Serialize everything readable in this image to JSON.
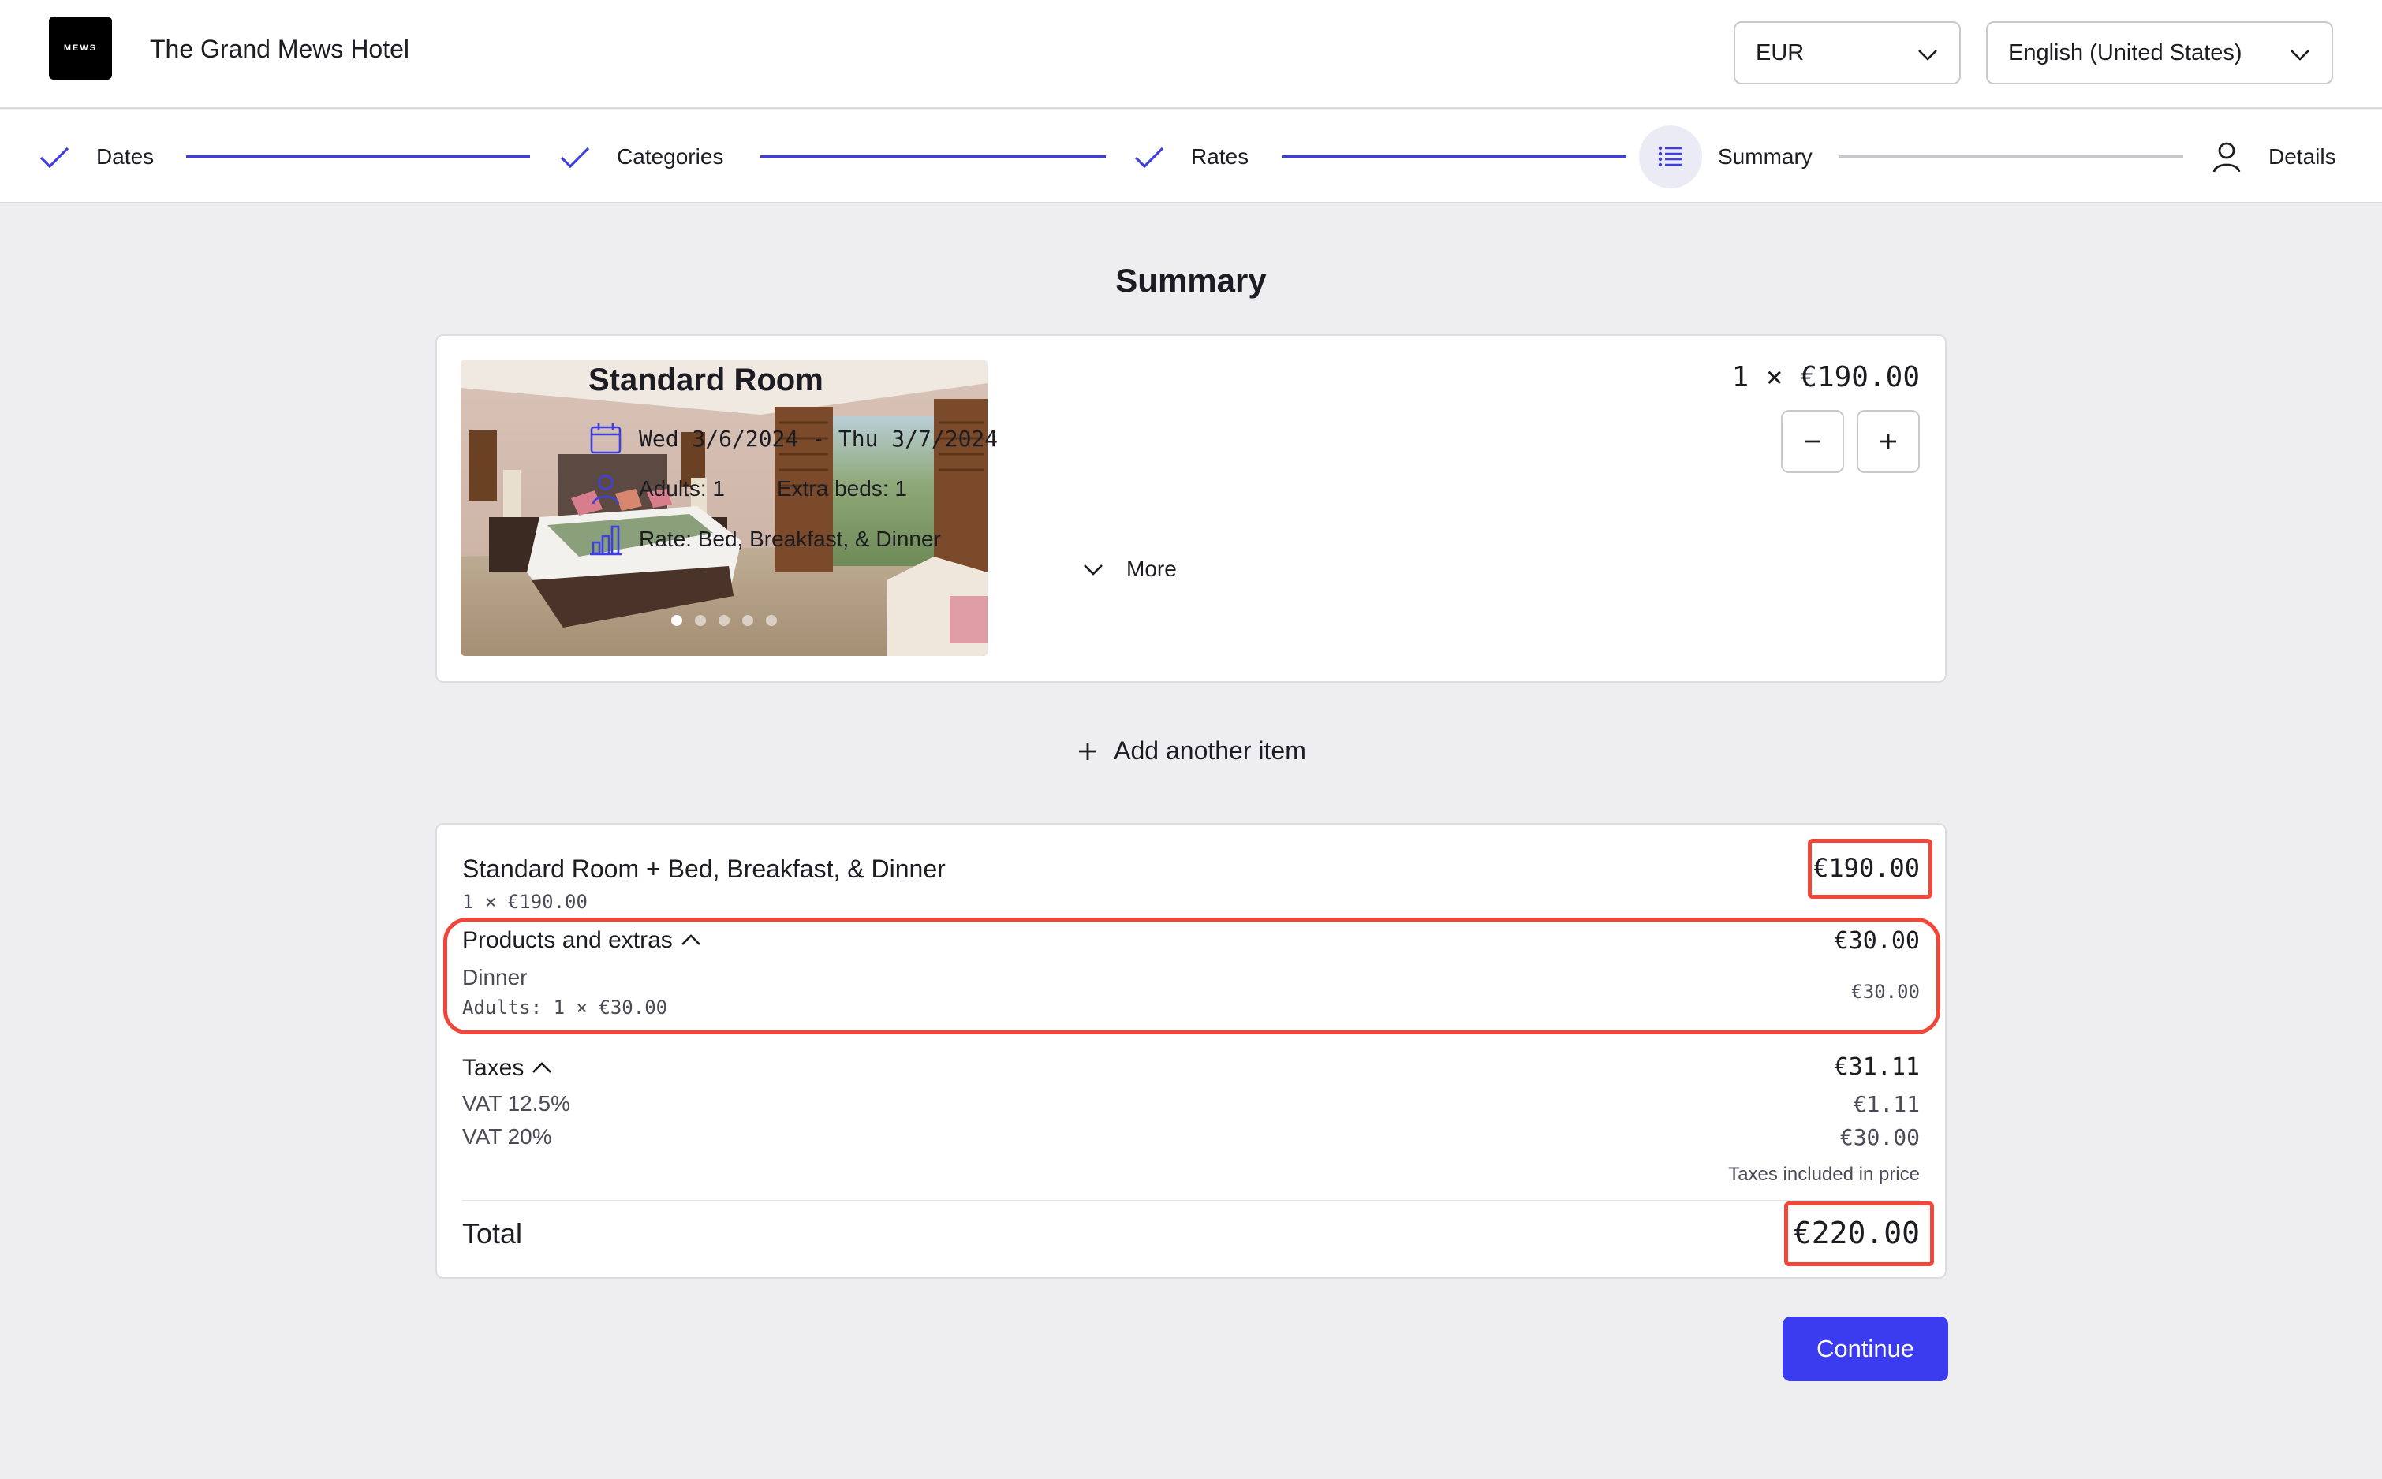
{
  "header": {
    "logo_text": "MEWS",
    "hotel_name": "The Grand Mews Hotel",
    "currency": "EUR",
    "language": "English (United States)"
  },
  "stepper": {
    "steps": [
      {
        "label": "Dates",
        "state": "complete"
      },
      {
        "label": "Categories",
        "state": "complete"
      },
      {
        "label": "Rates",
        "state": "complete"
      },
      {
        "label": "Summary",
        "state": "current"
      },
      {
        "label": "Details",
        "state": "upcoming"
      }
    ]
  },
  "page": {
    "title": "Summary"
  },
  "room": {
    "name": "Standard Room",
    "dates": "Wed 3/6/2024 - Thu 3/7/2024",
    "adults": "Adults: 1",
    "extra_beds": "Extra beds: 1",
    "rate": "Rate: Bed, Breakfast, & Dinner",
    "more_label": "More",
    "price": "1 × €190.00",
    "image_count": 5,
    "image_index": 1
  },
  "add_item_label": "Add another item",
  "summary": {
    "room_line": "Standard Room + Bed, Breakfast, & Dinner",
    "room_line_sub": "1 × €190.00",
    "room_line_price": "€190.00",
    "products_label": "Products and extras",
    "products_total": "€30.00",
    "dinner_label": "Dinner",
    "dinner_sub": "Adults: 1 × €30.00",
    "dinner_price": "€30.00",
    "taxes_label": "Taxes",
    "taxes_total": "€31.11",
    "vat1_label": "VAT 12.5%",
    "vat1_value": "€1.11",
    "vat2_label": "VAT 20%",
    "vat2_value": "€30.00",
    "taxes_note": "Taxes included in price",
    "total_label": "Total",
    "total_value": "€220.00"
  },
  "continue_label": "Continue",
  "colors": {
    "accent": "#3b3bf0",
    "highlight": "#f0473a",
    "background": "#eeeef1"
  }
}
